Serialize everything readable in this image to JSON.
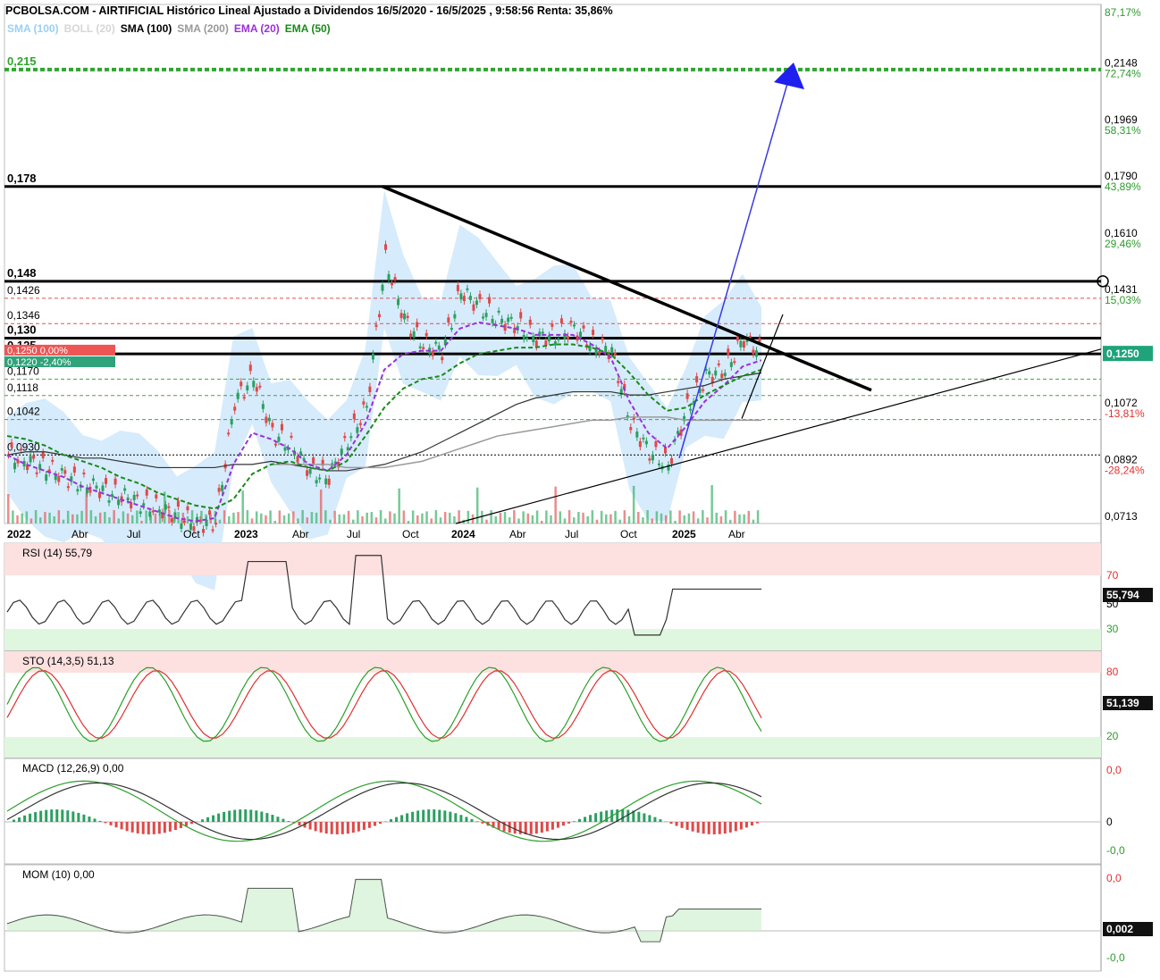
{
  "header": {
    "title": "PCBOLSA.COM - AIRTIFICIAL Histórico Lineal Ajustado a Dividendos 16/5/2020 - 16/5/2025 , 9:58:56 Renta: 35,86%"
  },
  "legend": [
    {
      "label": "SMA (100)",
      "color": "#9ad0f5"
    },
    {
      "label": "BOLL (20)",
      "color": "#d6d6d6"
    },
    {
      "label": "SMA (100)",
      "color": "#000000"
    },
    {
      "label": "SMA (200)",
      "color": "#9a9a9a"
    },
    {
      "label": "EMA (20)",
      "color": "#9b30d9"
    },
    {
      "label": "EMA (50)",
      "color": "#1a8a1a"
    }
  ],
  "price_axis": {
    "ticks": [
      {
        "value": 0.2148,
        "label": "0,2148",
        "pct": "72,74%",
        "pct_color": "#2e9b2e"
      },
      {
        "value": 0.1969,
        "label": "0,1969",
        "pct": "58,31%",
        "pct_color": "#2e9b2e"
      },
      {
        "value": 0.179,
        "label": "0,1790",
        "pct": "43,89%",
        "pct_color": "#2e9b2e"
      },
      {
        "value": 0.161,
        "label": "0,1610",
        "pct": "29,46%",
        "pct_color": "#2e9b2e"
      },
      {
        "value": 0.1431,
        "label": "0,1431",
        "pct": "15,03%",
        "pct_color": "#2e9b2e"
      },
      {
        "value": 0.1072,
        "label": "0,1072",
        "pct": "-13,81%",
        "pct_color": "#e23030"
      },
      {
        "value": 0.0892,
        "label": "0,0892",
        "pct": "-28,24%",
        "pct_color": "#e23030"
      },
      {
        "value": 0.0713,
        "label": "0,0713",
        "pct": "",
        "pct_color": "#e23030"
      }
    ],
    "top_pct": "87,17%",
    "current": "0,1250"
  },
  "levels": [
    {
      "value": 0.215,
      "label": "0,215",
      "style": "green-dotted"
    },
    {
      "value": 0.178,
      "label": "0,178",
      "style": "black-thick"
    },
    {
      "value": 0.148,
      "label": "0,148",
      "style": "black-thick"
    },
    {
      "value": 0.13,
      "label": "0,130",
      "style": "black-thick"
    },
    {
      "value": 0.125,
      "label": "0,125",
      "style": "black-thick"
    },
    {
      "value": 0.1426,
      "label": "0,1426",
      "style": "red-dashed"
    },
    {
      "value": 0.1346,
      "label": "0,1346",
      "style": "red-dashed"
    },
    {
      "value": 0.117,
      "label": "0,1170",
      "style": "green-dashed"
    },
    {
      "value": 0.1118,
      "label": "0,1118",
      "style": "green-dashed"
    },
    {
      "value": 0.1042,
      "label": "0,1042",
      "style": "green-dashed"
    },
    {
      "value": 0.093,
      "label": "0,0930",
      "style": "black-dotted"
    }
  ],
  "price_tags": {
    "tag1": "0,1250  0,00%",
    "tag2": "0,1220  -2,40%"
  },
  "x_axis": [
    "2022",
    "Jul",
    "Apr",
    "Jul",
    "Oct",
    "2023",
    "Abr",
    "Jul",
    "Oct",
    "2024",
    "Abr",
    "Jul",
    "Oct",
    "2025",
    "Abr"
  ],
  "x_labels": [
    {
      "label": "2022",
      "bold": true
    },
    {
      "label": "Abr",
      "bold": false
    },
    {
      "label": "Jul",
      "bold": false
    },
    {
      "label": "Oct",
      "bold": false
    },
    {
      "label": "2023",
      "bold": true
    },
    {
      "label": "Abr",
      "bold": false
    },
    {
      "label": "Jul",
      "bold": false
    },
    {
      "label": "Oct",
      "bold": false
    },
    {
      "label": "2024",
      "bold": true
    },
    {
      "label": "Abr",
      "bold": false
    },
    {
      "label": "Jul",
      "bold": false
    },
    {
      "label": "Oct",
      "bold": false
    },
    {
      "label": "2025",
      "bold": true
    },
    {
      "label": "Abr",
      "bold": false
    }
  ],
  "panels": {
    "rsi": {
      "title": "RSI (14)",
      "value": "55,79",
      "tag": "55,794",
      "levels": [
        "70",
        "50",
        "30"
      ]
    },
    "sto": {
      "title": "STO (14,3,5)",
      "value": "51,13",
      "tag": "51,139",
      "levels": [
        "80",
        "20"
      ]
    },
    "macd": {
      "title": "MACD (12,26,9)",
      "value": "0,00",
      "levels": [
        "0,0",
        "0",
        "-0,0"
      ]
    },
    "mom": {
      "title": "MOM (10)",
      "value": "0,00",
      "tag": "0,002",
      "levels": [
        "0,0",
        "-0,0"
      ]
    }
  },
  "chart_data": {
    "type": "line",
    "title": "PCBOLSA.COM - AIRTIFICIAL Histórico Lineal Ajustado a Dividendos 16/5/2020 - 16/5/2025 , 9:58:56 Renta: 35,86%",
    "x": [
      "2022-01",
      "2022-02",
      "2022-03",
      "2022-04",
      "2022-05",
      "2022-06",
      "2022-07",
      "2022-08",
      "2022-09",
      "2022-10",
      "2022-11",
      "2022-12",
      "2023-01",
      "2023-02",
      "2023-03",
      "2023-04",
      "2023-05",
      "2023-06",
      "2023-07",
      "2023-08",
      "2023-09",
      "2023-10",
      "2023-11",
      "2023-12",
      "2024-01",
      "2024-02",
      "2024-03",
      "2024-04",
      "2024-05",
      "2024-06",
      "2024-07",
      "2024-08",
      "2024-09",
      "2024-10",
      "2024-11",
      "2024-12",
      "2025-01",
      "2025-02",
      "2025-03",
      "2025-04",
      "2025-05"
    ],
    "series": [
      {
        "values": [
          0.093,
          0.091,
          0.089,
          0.086,
          0.084,
          0.082,
          0.08,
          0.078,
          0.076,
          0.074,
          0.071,
          0.072,
          0.11,
          0.118,
          0.1,
          0.096,
          0.088,
          0.086,
          0.098,
          0.108,
          0.155,
          0.136,
          0.128,
          0.126,
          0.145,
          0.14,
          0.136,
          0.134,
          0.13,
          0.131,
          0.133,
          0.128,
          0.126,
          0.103,
          0.094,
          0.09,
          0.108,
          0.118,
          0.12,
          0.13,
          0.125
        ]
      },
      {
        "name": "SMA (100)",
        "values": [
          0.093,
          0.094,
          0.094,
          0.093,
          0.092,
          0.092,
          0.091,
          0.09,
          0.089,
          0.089,
          0.089,
          0.089,
          0.09,
          0.09,
          0.091,
          0.09,
          0.089,
          0.088,
          0.088,
          0.089,
          0.09,
          0.092,
          0.094,
          0.097,
          0.1,
          0.103,
          0.106,
          0.109,
          0.111,
          0.112,
          0.113,
          0.113,
          0.113,
          0.112,
          0.112,
          0.113,
          0.114,
          0.115,
          0.117,
          0.118,
          0.119
        ]
      },
      {
        "name": "SMA (200)",
        "values": [
          null,
          null,
          null,
          null,
          null,
          null,
          null,
          null,
          null,
          null,
          null,
          null,
          null,
          null,
          0.09,
          0.09,
          0.09,
          0.09,
          0.089,
          0.089,
          0.089,
          0.09,
          0.091,
          0.093,
          0.095,
          0.097,
          0.099,
          0.1,
          0.101,
          0.102,
          0.103,
          0.104,
          0.104,
          0.105,
          0.105,
          0.105,
          0.104,
          0.104,
          0.104,
          0.104,
          0.104
        ]
      },
      {
        "name": "EMA (20)",
        "values": [
          0.093,
          0.09,
          0.088,
          0.086,
          0.083,
          0.081,
          0.079,
          0.077,
          0.075,
          0.073,
          0.072,
          0.073,
          0.09,
          0.1,
          0.098,
          0.095,
          0.09,
          0.088,
          0.093,
          0.103,
          0.12,
          0.125,
          0.126,
          0.126,
          0.133,
          0.135,
          0.134,
          0.133,
          0.131,
          0.131,
          0.131,
          0.128,
          0.124,
          0.11,
          0.1,
          0.095,
          0.102,
          0.11,
          0.115,
          0.121,
          0.123
        ]
      },
      {
        "name": "EMA (50)",
        "values": [
          0.099,
          0.098,
          0.096,
          0.093,
          0.091,
          0.089,
          0.086,
          0.084,
          0.081,
          0.079,
          0.077,
          0.076,
          0.079,
          0.087,
          0.09,
          0.091,
          0.089,
          0.088,
          0.091,
          0.099,
          0.108,
          0.114,
          0.117,
          0.118,
          0.122,
          0.125,
          0.126,
          0.127,
          0.127,
          0.128,
          0.128,
          0.127,
          0.125,
          0.119,
          0.112,
          0.107,
          0.108,
          0.112,
          0.115,
          0.118,
          0.12
        ]
      }
    ],
    "ylim": [
      0.0713,
      0.2328
    ],
    "grid": false,
    "legend_placement": "top-left"
  }
}
